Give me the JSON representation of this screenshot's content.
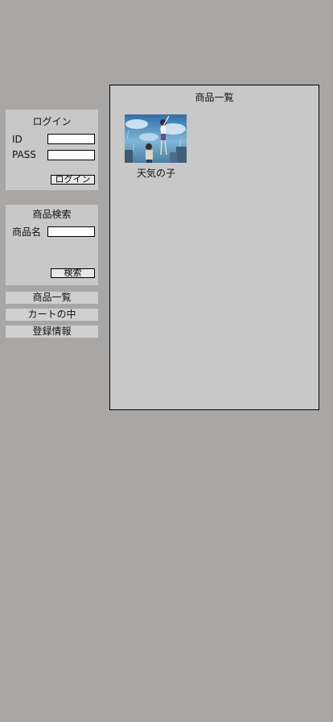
{
  "login": {
    "title": "ログイン",
    "id_label": "ID",
    "id_value": "",
    "pass_label": "PASS",
    "pass_value": "",
    "submit_label": "ログイン"
  },
  "search": {
    "title": "商品検索",
    "name_label": "商品名",
    "name_value": "",
    "submit_label": "検索"
  },
  "nav": {
    "items": [
      {
        "label": "商品一覧"
      },
      {
        "label": "カートの中"
      },
      {
        "label": "登録情報"
      }
    ]
  },
  "main": {
    "title": "商品一覧",
    "products": [
      {
        "name": "天気の子"
      }
    ]
  }
}
